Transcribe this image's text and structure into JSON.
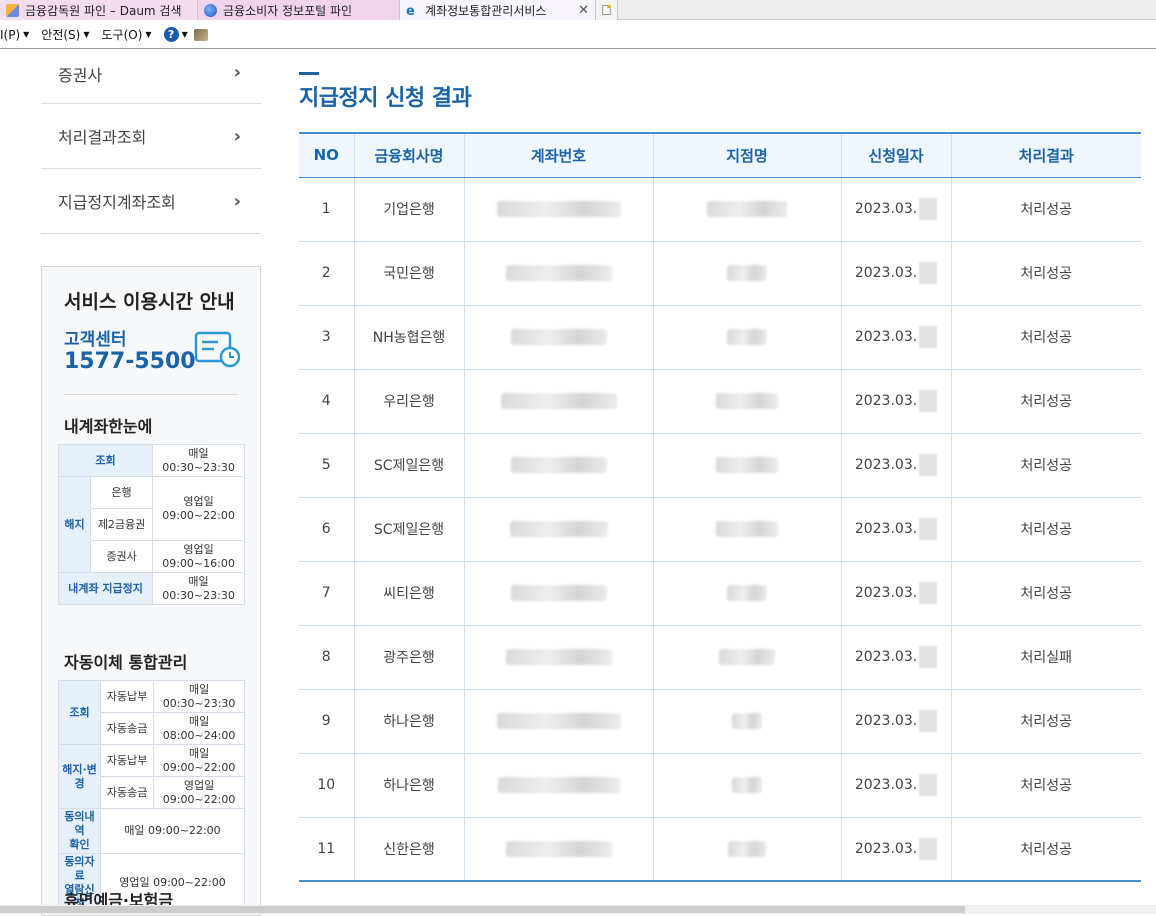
{
  "browser": {
    "tabs": [
      {
        "label": "금융감독원 파인 – Daum 검색",
        "icon": "daum-favicon"
      },
      {
        "label": "금융소비자 정보포털 파인",
        "icon": "globe-favicon"
      },
      {
        "label": "계좌정보통합관리서비스",
        "icon": "ie-favicon",
        "active": true
      }
    ],
    "close_glyph": "✕",
    "menu": [
      "I(P)",
      "안전(S)",
      "도구(O)"
    ]
  },
  "sidebar": {
    "items": [
      {
        "label": "증권사"
      },
      {
        "label": "처리결과조회"
      },
      {
        "label": "지급정지계좌조회"
      }
    ],
    "service_box": {
      "title": "서비스 이용시간 안내",
      "cc_label": "고객센터",
      "cc_phone": "1577-5500",
      "section1": {
        "title": "내계좌한눈에",
        "rows": {
          "inquiry": "조회",
          "inquiry_time": "매일\n00:30~23:30",
          "cancel": "해지",
          "bank": "은행",
          "second_fin": "제2금융권",
          "bank_time": "영업일\n09:00~22:00",
          "securities": "증권사",
          "securities_time": "영업일\n09:00~16:00",
          "stop": "내계좌 지급정지",
          "stop_time": "매일\n00:30~23:30"
        }
      },
      "section2": {
        "title": "자동이체 통합관리",
        "rows": {
          "inquiry": "조회",
          "auto_pay": "자동납부",
          "auto_pay_time": "매일\n00:30~23:30",
          "auto_send": "자동송금",
          "auto_send_time": "매일\n08:00~24:00",
          "change": "해지·변경",
          "change_pay": "자동납부",
          "change_pay_time": "매일\n09:00~22:00",
          "change_send": "자동송금",
          "change_send_time": "영업일\n09:00~22:00",
          "consent_check": "동의내역\n확인",
          "consent_check_time": "매일 09:00~22:00",
          "consent_req": "동의자료\n열람신청",
          "consent_req_time": "영업일 09:00~22:00"
        }
      },
      "section3_title": "휴면예금·보험금"
    }
  },
  "main": {
    "title": "지급정지 신청 결과",
    "headers": [
      "NO",
      "금융회사명",
      "계좌번호",
      "지점명",
      "신청일자",
      "처리결과"
    ],
    "rows": [
      {
        "no": "1",
        "company": "기업은행",
        "date": "2023.03.",
        "result": "처리성공"
      },
      {
        "no": "2",
        "company": "국민은행",
        "date": "2023.03.",
        "result": "처리성공"
      },
      {
        "no": "3",
        "company": "NH농협은행",
        "date": "2023.03.",
        "result": "처리성공"
      },
      {
        "no": "4",
        "company": "우리은행",
        "date": "2023.03.",
        "result": "처리성공"
      },
      {
        "no": "5",
        "company": "SC제일은행",
        "date": "2023.03.",
        "result": "처리성공"
      },
      {
        "no": "6",
        "company": "SC제일은행",
        "date": "2023.03.",
        "result": "처리성공"
      },
      {
        "no": "7",
        "company": "씨티은행",
        "date": "2023.03.",
        "result": "처리성공"
      },
      {
        "no": "8",
        "company": "광주은행",
        "date": "2023.03.",
        "result": "처리실패"
      },
      {
        "no": "9",
        "company": "하나은행",
        "date": "2023.03.",
        "result": "처리성공"
      },
      {
        "no": "10",
        "company": "하나은행",
        "date": "2023.03.",
        "result": "처리성공"
      },
      {
        "no": "11",
        "company": "신한은행",
        "date": "2023.03.",
        "result": "처리성공"
      }
    ]
  }
}
